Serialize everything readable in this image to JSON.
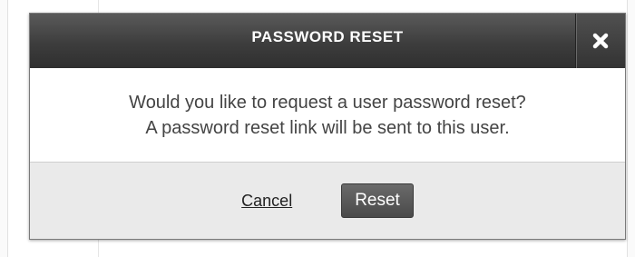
{
  "dialog": {
    "title": "PASSWORD RESET",
    "close_icon": "close-icon",
    "message_line1": "Would you like to request a user password reset?",
    "message_line2": "A password reset link will be sent to this user.",
    "cancel_label": "Cancel",
    "reset_label": "Reset"
  },
  "colors": {
    "header_bg": "#3d3d3d",
    "header_text": "#ffffff",
    "footer_bg": "#eaeaea",
    "reset_button_bg": "#5a5a5a"
  }
}
